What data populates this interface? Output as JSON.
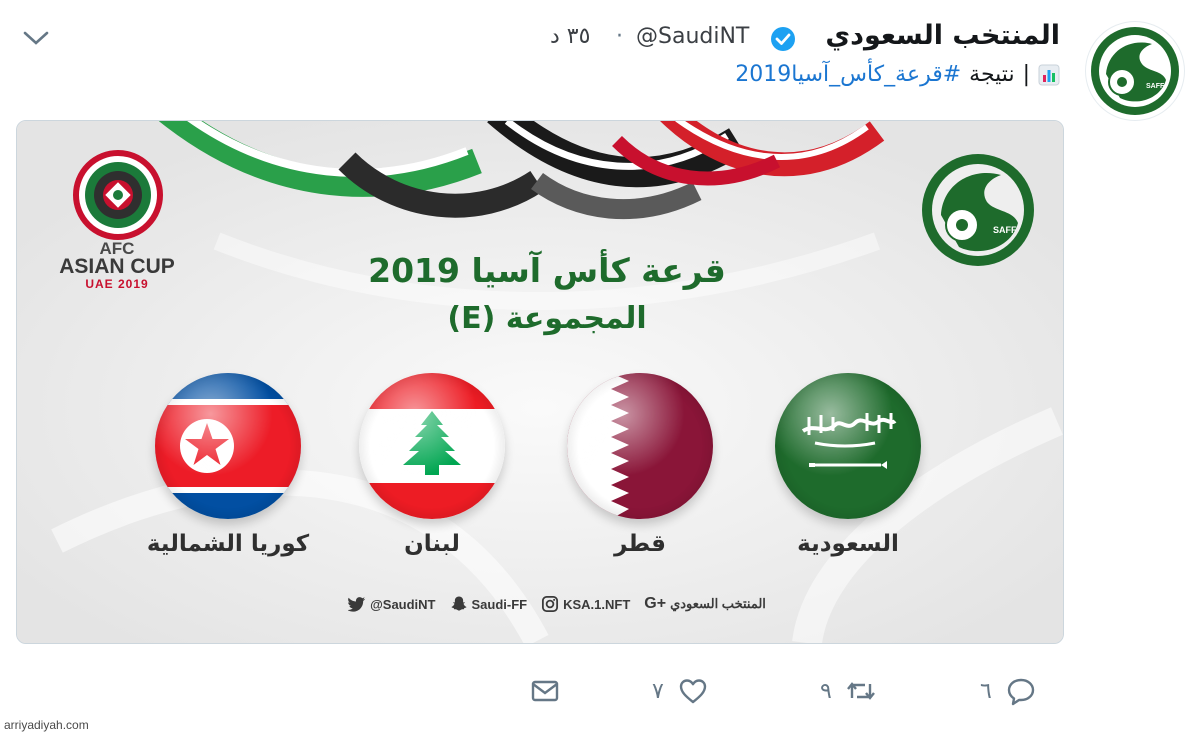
{
  "tweet": {
    "display_name": "المنتخب السعودي",
    "handle": "@SaudiNT",
    "time_separator": "·",
    "time": "٣٥ د",
    "body_text": "نتيجة",
    "body_separator": "|",
    "hashtag": "#قرعة_كأس_آسيا2019",
    "verified_color": "#1da1f2"
  },
  "card": {
    "afc_line1": "AFC",
    "afc_line2": "ASIAN CUP",
    "afc_line3": "UAE 2019",
    "title": "قرعة كأس آسيا 2019",
    "subtitle": "المجموعة (E)",
    "teams": [
      {
        "name": "السعودية",
        "flag": "saudi-arabia"
      },
      {
        "name": "قطر",
        "flag": "qatar"
      },
      {
        "name": "لبنان",
        "flag": "lebanon"
      },
      {
        "name": "كوريا الشمالية",
        "flag": "north-korea"
      }
    ],
    "social": {
      "twitter": "@SaudiNT",
      "snapchat": "Saudi-FF",
      "instagram": "KSA.1.NFT",
      "gplus_name": "المنتخب السعودي",
      "gplus_icon": "G+"
    },
    "accent_green": "#1e6b2c"
  },
  "actions": {
    "reply_count": "٦",
    "retweet_count": "٩",
    "like_count": "٧"
  },
  "footer": {
    "watermark": "arriyadiyah.com"
  }
}
